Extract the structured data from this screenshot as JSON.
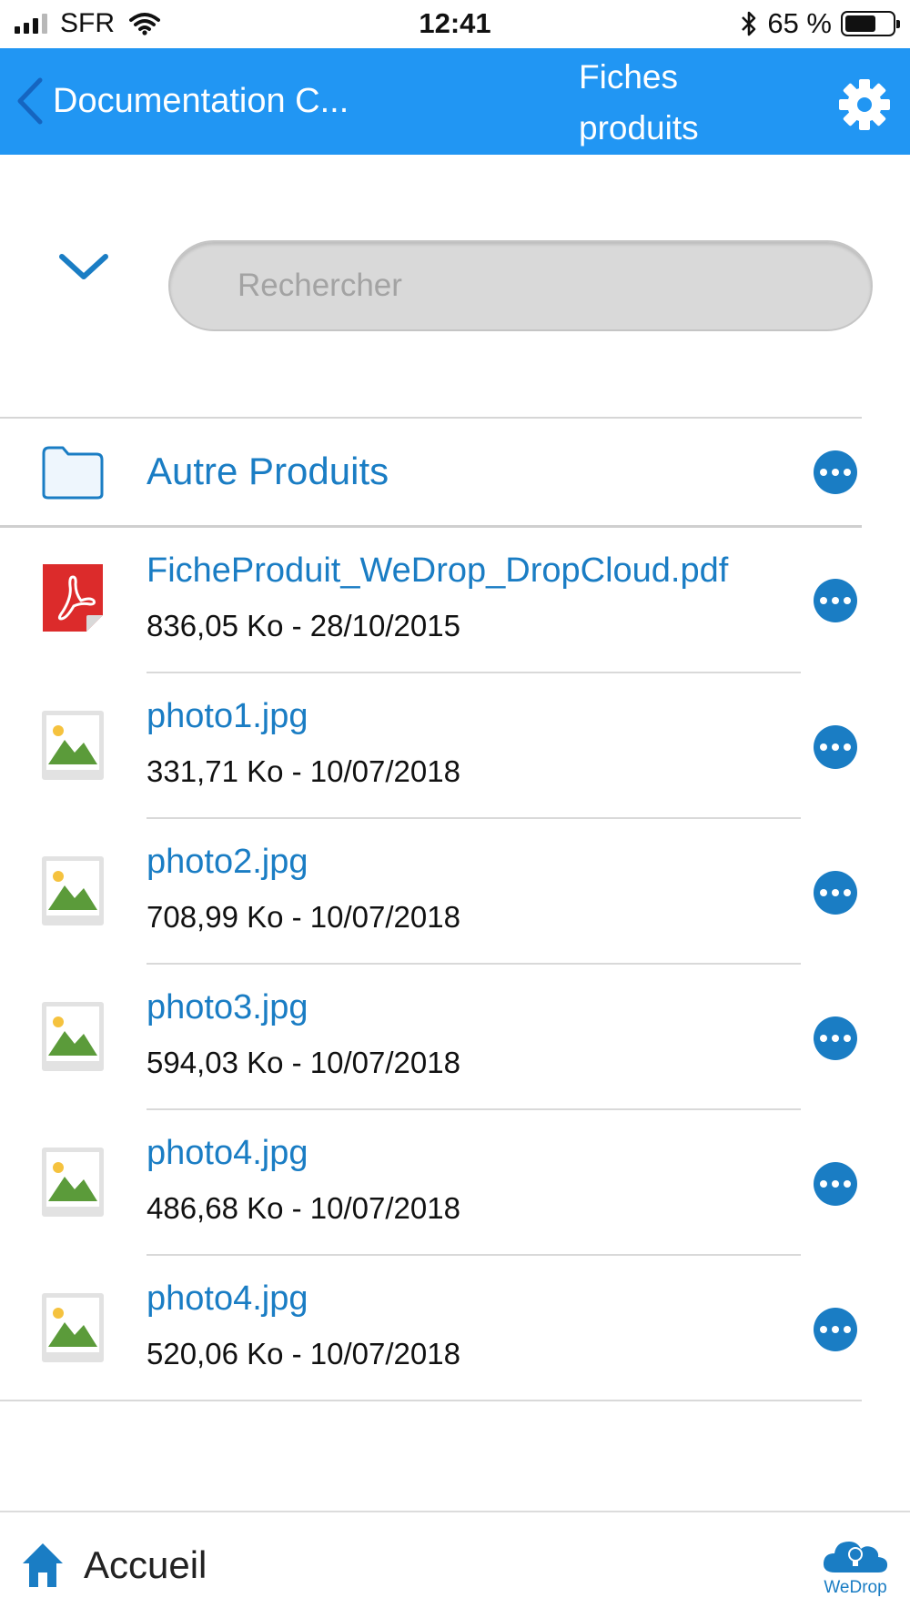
{
  "status_bar": {
    "carrier": "SFR",
    "time": "12:41",
    "battery": "65 %",
    "battery_level": 0.65
  },
  "nav": {
    "back_label": "Documentation C...",
    "title": "Fiches produits"
  },
  "search": {
    "placeholder": "Rechercher",
    "value": ""
  },
  "folders": [
    {
      "name": "Autre Produits"
    }
  ],
  "files": [
    {
      "name": "FicheProduit_WeDrop_DropCloud.pdf",
      "meta": "836,05 Ko - 28/10/2015",
      "icon": "pdf-file-icon"
    },
    {
      "name": "photo1.jpg",
      "meta": "331,71 Ko - 10/07/2018",
      "icon": "image-file-icon"
    },
    {
      "name": "photo2.jpg",
      "meta": "708,99 Ko - 10/07/2018",
      "icon": "image-file-icon"
    },
    {
      "name": "photo3.jpg",
      "meta": "594,03 Ko - 10/07/2018",
      "icon": "image-file-icon"
    },
    {
      "name": "photo4.jpg",
      "meta": "486,68 Ko - 10/07/2018",
      "icon": "image-file-icon"
    },
    {
      "name": "photo4.jpg",
      "meta": "520,06 Ko - 10/07/2018",
      "icon": "image-file-icon"
    }
  ],
  "bottom_bar": {
    "home_label": "Accueil",
    "logo_text": "WeDrop"
  },
  "colors": {
    "nav_background": "#2196f3",
    "link_blue": "#1a7dc4"
  }
}
